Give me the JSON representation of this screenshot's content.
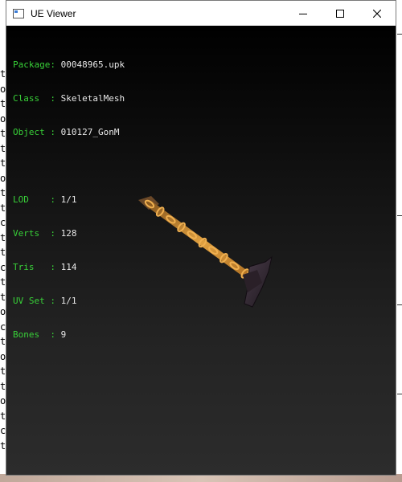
{
  "window": {
    "title": "UE Viewer",
    "icon": "app-window-icon",
    "controls": [
      "minimize-icon",
      "maximize-icon",
      "close-icon"
    ]
  },
  "info": {
    "group1": [
      {
        "label": "Package",
        "pad": "Package",
        "value": "00048965.upk"
      },
      {
        "label": "Class  ",
        "pad": "Class",
        "value": "SkeletalMesh"
      },
      {
        "label": "Object ",
        "pad": "Object",
        "value": "010127_GonM"
      }
    ],
    "group2": [
      {
        "label": "LOD    ",
        "value": "1/1"
      },
      {
        "label": "Verts  ",
        "value": "128"
      },
      {
        "label": "Tris   ",
        "value": "114"
      },
      {
        "label": "UV Set ",
        "value": "1/1"
      },
      {
        "label": "Bones  ",
        "value": "9"
      }
    ],
    "separator": ": "
  },
  "colors": {
    "label": "#38d038",
    "value": "#e8e8e8",
    "chain": "#d08a28",
    "head": "#3a2e3a"
  },
  "background": {
    "left_glyphs": [
      "t",
      "o",
      "t",
      "o",
      "t",
      "t",
      "t",
      "o",
      "t",
      "t",
      "c",
      "t",
      "t",
      "c",
      "t",
      "t",
      "o",
      "c",
      "t",
      "o",
      "t",
      "t",
      "o",
      "t",
      "c",
      "t"
    ]
  }
}
